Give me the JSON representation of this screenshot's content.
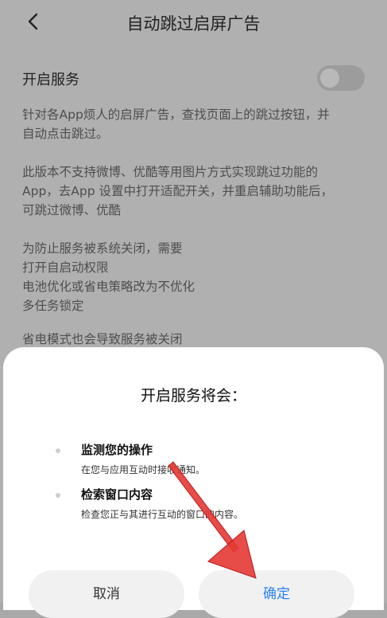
{
  "header": {
    "title": "自动跳过启屏广告",
    "back_icon": "chevron-left-icon"
  },
  "service": {
    "label": "开启服务",
    "toggle_state": "off"
  },
  "descriptions": [
    "针对各App烦人的启屏广告，查找页面上的跳过按钮，并\n自动点击跳过。",
    "此版本不支持微博、优酷等用图片方式实现跳过功能的\nApp，去App 设置中打开适配开关，并重启辅助功能后，\n可跳过微博、优酷",
    "为防止服务被系统关闭，需要\n  打开自启动权限\n  电池优化或省电策略改为不优化\n  多任务锁定",
    "省电模式也会导致服务被关闭"
  ],
  "dialog": {
    "title": "开启服务将会：",
    "permissions": [
      {
        "title": "监测您的操作",
        "subtitle": "在您与应用互动时接收通知。"
      },
      {
        "title": "检索窗口内容",
        "subtitle": "检查您正与其进行互动的窗口的内容。"
      }
    ],
    "cancel_label": "取消",
    "confirm_label": "确定"
  },
  "colors": {
    "accent": "#2a82f7",
    "arrow": "#e53935"
  }
}
